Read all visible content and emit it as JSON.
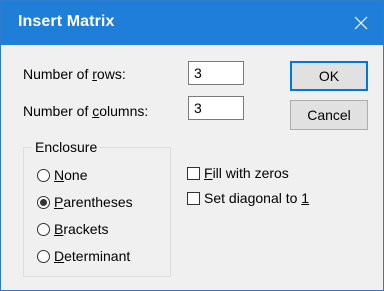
{
  "window": {
    "title": "Insert Matrix"
  },
  "fields": {
    "rows": {
      "label_pre": "Number of ",
      "label_key": "r",
      "label_post": "ows:",
      "value": "3"
    },
    "columns": {
      "label_pre": "Number of ",
      "label_key": "c",
      "label_post": "olumns:",
      "value": "3"
    }
  },
  "buttons": {
    "ok": "OK",
    "cancel": "Cancel"
  },
  "enclosure": {
    "legend": "Enclosure",
    "options": [
      {
        "key": "N",
        "rest": "one",
        "selected": false
      },
      {
        "key": "P",
        "rest": "arentheses",
        "selected": true
      },
      {
        "key": "B",
        "rest": "rackets",
        "selected": false
      },
      {
        "key": "D",
        "rest": "eterminant",
        "selected": false
      }
    ]
  },
  "checkboxes": {
    "fill_zeros": {
      "key": "F",
      "rest": "ill with zeros",
      "checked": false
    },
    "diagonal": {
      "pre": "Set diagonal to ",
      "key": "1",
      "checked": false
    }
  },
  "colors": {
    "titlebar": "#1f7fd8",
    "accent": "#0078d7"
  },
  "icons": {
    "close": "close-icon"
  }
}
